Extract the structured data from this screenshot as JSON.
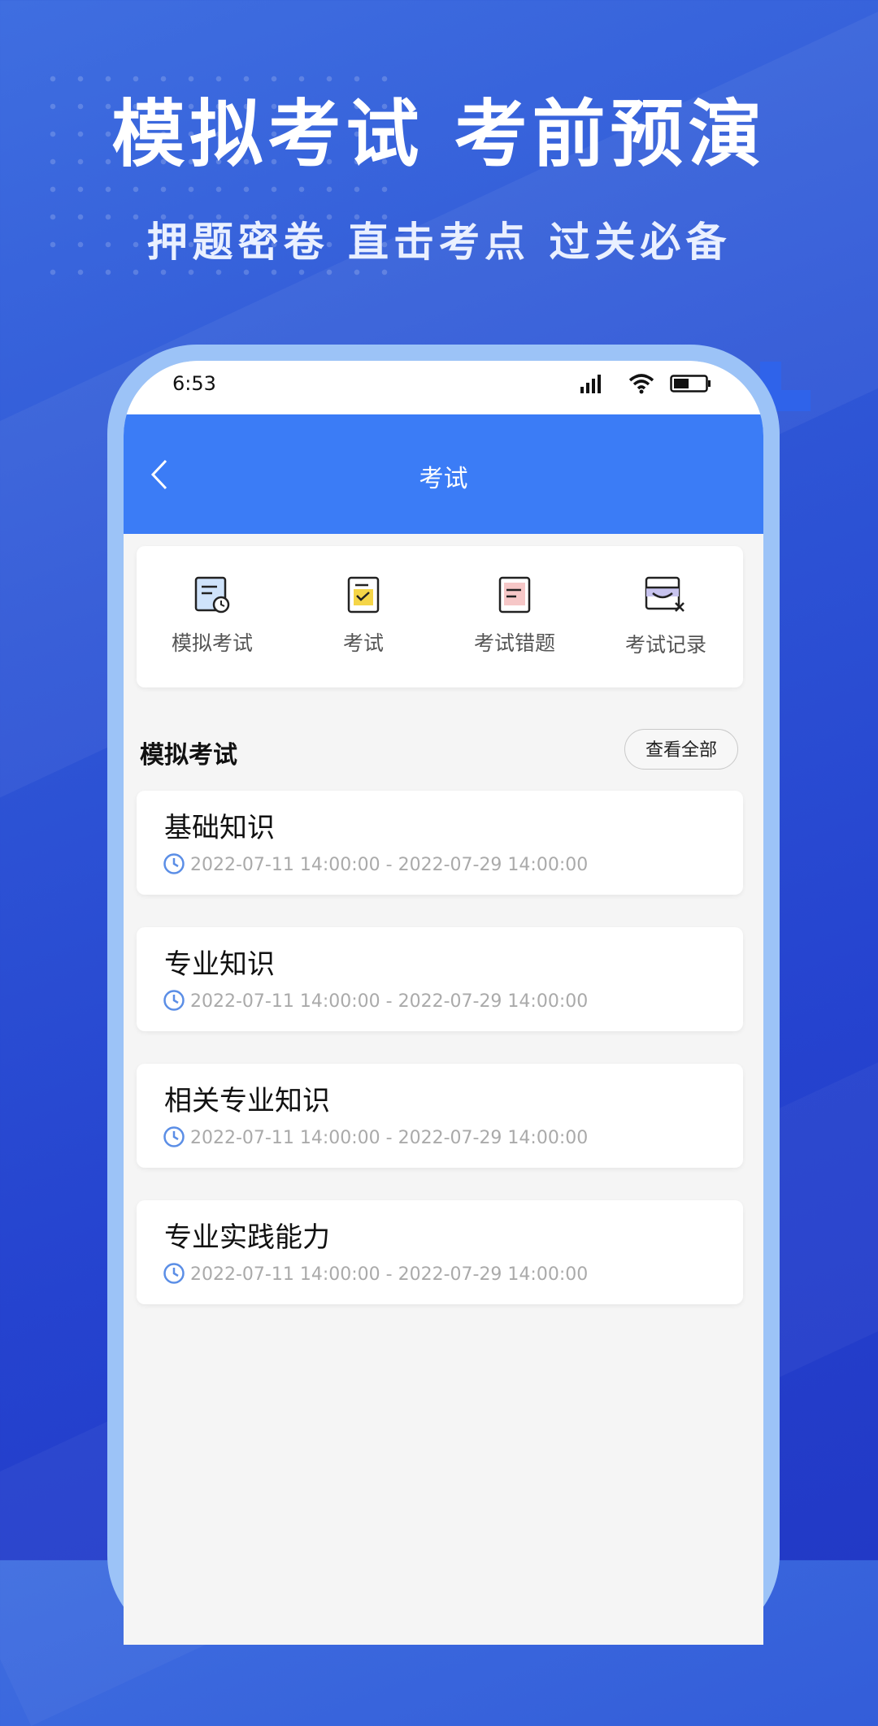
{
  "promo": {
    "headline": "模拟考试 考前预演",
    "subheadline": "押题密卷 直击考点 过关必备"
  },
  "status_bar": {
    "time": "6:53"
  },
  "app_bar": {
    "title": "考试"
  },
  "menu": [
    {
      "label": "模拟考试",
      "icon": "exam-clock-icon"
    },
    {
      "label": "考试",
      "icon": "checklist-icon"
    },
    {
      "label": "考试错题",
      "icon": "wrong-questions-icon"
    },
    {
      "label": "考试记录",
      "icon": "records-icon"
    }
  ],
  "section": {
    "title": "模拟考试",
    "view_all": "查看全部"
  },
  "exams": [
    {
      "title": "基础知识",
      "time": "2022-07-11 14:00:00 - 2022-07-29 14:00:00"
    },
    {
      "title": "专业知识",
      "time": "2022-07-11 14:00:00 - 2022-07-29 14:00:00"
    },
    {
      "title": "相关专业知识",
      "time": "2022-07-11 14:00:00 - 2022-07-29 14:00:00"
    },
    {
      "title": "专业实践能力",
      "time": "2022-07-11 14:00:00 - 2022-07-29 14:00:00"
    }
  ],
  "colors": {
    "brand": "#3b7cf6",
    "frame": "#9cc3f7"
  }
}
